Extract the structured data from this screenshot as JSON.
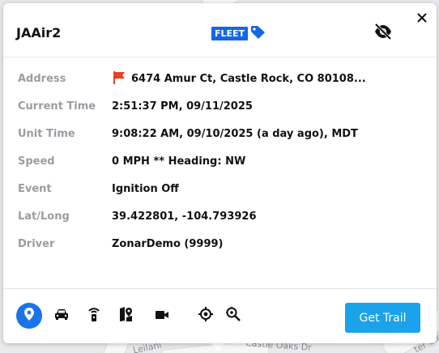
{
  "unit": {
    "name": "JAAir2",
    "fleet_badge": "FLEET"
  },
  "details": [
    {
      "key": "address",
      "label": "Address",
      "value": "6474 Amur Ct, Castle Rock, CO 80108..."
    },
    {
      "key": "current_time",
      "label": "Current Time",
      "value": "2:51:37 PM, 09/11/2025"
    },
    {
      "key": "unit_time",
      "label": "Unit Time",
      "value": "9:08:22 AM, 09/10/2025 (a day ago), MDT"
    },
    {
      "key": "speed",
      "label": "Speed",
      "value": "0 MPH ** Heading: NW"
    },
    {
      "key": "event",
      "label": "Event",
      "value": "Ignition Off"
    },
    {
      "key": "latlong",
      "label": "Lat/Long",
      "value": "39.422801, -104.793926"
    },
    {
      "key": "driver",
      "label": "Driver",
      "value": "ZonarDemo (9999)"
    }
  ],
  "footer": {
    "icons": [
      "location-pin-icon",
      "car-icon",
      "tracker-icon",
      "map-pins-icon",
      "camera-icon",
      "crosshair-icon",
      "zoom-to-icon"
    ],
    "get_trail_label": "Get Trail"
  },
  "map": {
    "labels": [
      "Leilani",
      "Castle Oaks Dr",
      "ter Cir"
    ]
  },
  "colors": {
    "accent": "#1a73e8",
    "button": "#1aa3ea",
    "badge": "#1466e6",
    "flag": "#e8401c"
  }
}
